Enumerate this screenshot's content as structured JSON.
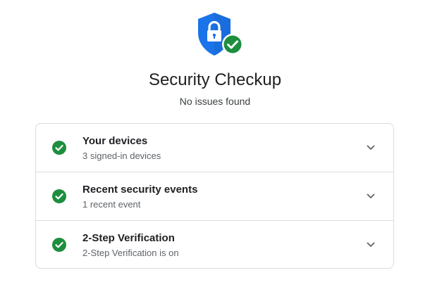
{
  "header": {
    "title": "Security Checkup",
    "subtitle": "No issues found",
    "icon": "shield-lock-check-icon"
  },
  "colors": {
    "shield_blue": "#1a73e8",
    "shield_dark": "#1967d2",
    "check_green": "#1e8e3e",
    "border": "#dadce0"
  },
  "items": [
    {
      "title": "Your devices",
      "description": "3 signed-in devices",
      "status": "ok",
      "icon": "check-circle-icon"
    },
    {
      "title": "Recent security events",
      "description": "1 recent event",
      "status": "ok",
      "icon": "check-circle-icon"
    },
    {
      "title": "2-Step Verification",
      "description": "2-Step Verification is on",
      "status": "ok",
      "icon": "check-circle-icon"
    }
  ]
}
